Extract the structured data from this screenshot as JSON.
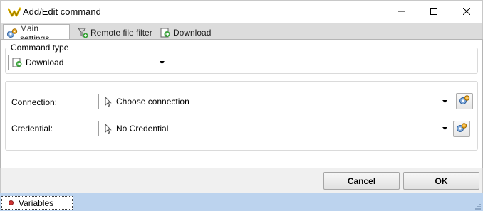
{
  "window": {
    "title": "Add/Edit command",
    "icon": "app-logo-icon",
    "controls": [
      "minimize-icon",
      "maximize-icon",
      "close-icon"
    ]
  },
  "tabs": [
    {
      "label": "Main settings",
      "icon": "gear-settings-icon",
      "active": true
    },
    {
      "label": "Remote file filter",
      "icon": "filter-add-icon",
      "active": false
    },
    {
      "label": "Download",
      "icon": "download-icon",
      "active": false
    }
  ],
  "command_type": {
    "legend": "Command type",
    "value": "Download",
    "icon": "download-icon"
  },
  "connection": {
    "label": "Connection:",
    "value": "Choose connection",
    "icon": "cursor-pointer-icon"
  },
  "credential": {
    "label": "Credential:",
    "value": "No Credential",
    "icon": "cursor-pointer-icon"
  },
  "buttons": {
    "cancel": "Cancel",
    "ok": "OK"
  },
  "statusbar": {
    "variables": "Variables"
  },
  "colors": {
    "statusbar": "#bcd3ee",
    "accent": "#3a8ed6"
  }
}
